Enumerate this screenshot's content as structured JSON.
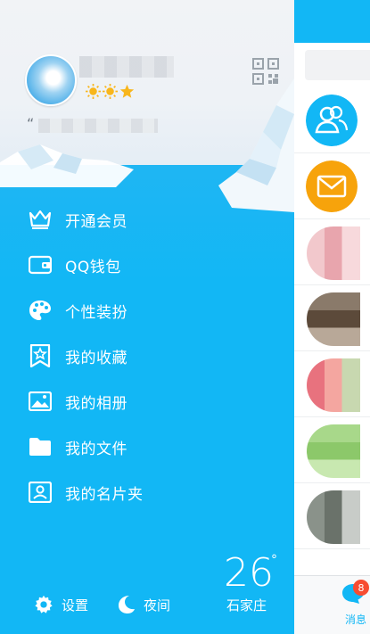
{
  "profile": {
    "quote_mark": "“"
  },
  "menu": [
    {
      "label": "开通会员",
      "icon": "crown-icon"
    },
    {
      "label": "QQ钱包",
      "icon": "wallet-icon"
    },
    {
      "label": "个性装扮",
      "icon": "palette-icon"
    },
    {
      "label": "我的收藏",
      "icon": "star-bookmark-icon"
    },
    {
      "label": "我的相册",
      "icon": "photo-album-icon"
    },
    {
      "label": "我的文件",
      "icon": "folder-icon"
    },
    {
      "label": "我的名片夹",
      "icon": "card-holder-icon"
    }
  ],
  "bottom": {
    "settings_label": "设置",
    "night_label": "夜间"
  },
  "weather": {
    "temperature": "26",
    "degree_symbol": "°",
    "city": "石家庄"
  },
  "tabbar": {
    "messages_label": "消息",
    "badge_count": "8"
  },
  "colors": {
    "accent": "#12b7f5",
    "badge": "#f74c31",
    "mail_icon": "#f7a30b"
  }
}
